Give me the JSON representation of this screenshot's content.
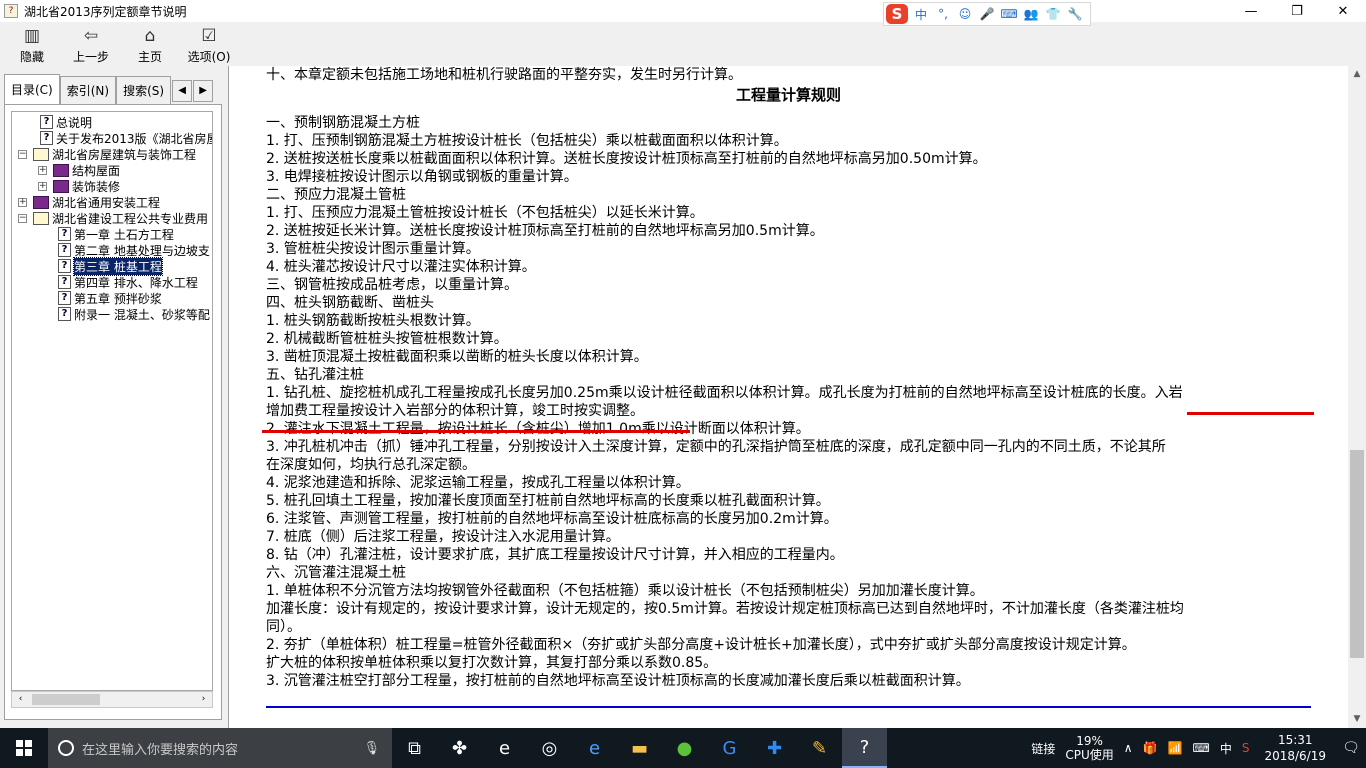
{
  "window": {
    "title": "湖北省2013序列定额章节说明",
    "caps": [
      "—",
      "❐",
      "✕"
    ]
  },
  "ime": {
    "items": [
      "中",
      "°,",
      "☺",
      "🎤",
      "⌨",
      "👥",
      "👕",
      "🔧"
    ]
  },
  "toolbar": {
    "buttons": [
      {
        "label": "隐藏",
        "icon": "hide-icon"
      },
      {
        "label": "上一步",
        "icon": "back-icon"
      },
      {
        "label": "主页",
        "icon": "home-icon"
      },
      {
        "label": "选项(O)",
        "icon": "options-icon"
      }
    ]
  },
  "tabs": [
    "目录(C)",
    "索引(N)",
    "搜索(S)"
  ],
  "tree": {
    "items": [
      {
        "label": "总说明"
      },
      {
        "label": "关于发布2013版《湖北省房屋"
      },
      {
        "label": "湖北省房屋建筑与装饰工程"
      },
      {
        "label": "结构屋面"
      },
      {
        "label": "装饰装修"
      },
      {
        "label": "湖北省通用安装工程"
      },
      {
        "label": "湖北省建设工程公共专业费用"
      },
      {
        "label": "第一章  土石方工程"
      },
      {
        "label": "第二章  地基处理与边坡支"
      },
      {
        "label": "第三章  桩基工程"
      },
      {
        "label": "第四章  排水、降水工程"
      },
      {
        "label": "第五章  预拌砂浆"
      },
      {
        "label": "附录一  混凝土、砂浆等配"
      }
    ]
  },
  "content": {
    "intro": "十、本章定额未包括施工场地和桩机行驶路面的平整夯实，发生时另行计算。",
    "title": "工程量计算规则",
    "lines": [
      "一、预制钢筋混凝土方桩",
      "1. 打、压预制钢筋混凝土方桩按设计桩长（包括桩尖）乘以桩截面面积以体积计算。",
      "2. 送桩按送桩长度乘以桩截面面积以体积计算。送桩长度按设计桩顶标高至打桩前的自然地坪标高另加0.50m计算。",
      "3. 电焊接桩按设计图示以角钢或钢板的重量计算。",
      "二、预应力混凝土管桩",
      "1. 打、压预应力混凝土管桩按设计桩长（不包括桩尖）以延长米计算。",
      "2. 送桩按延长米计算。送桩长度按设计桩顶标高至打桩前的自然地坪标高另加0.5m计算。",
      "3. 管桩桩尖按设计图示重量计算。",
      "4. 桩头灌芯按设计尺寸以灌注实体积计算。",
      "三、钢管桩按成品桩考虑，以重量计算。",
      "四、桩头钢筋截断、凿桩头",
      "1. 桩头钢筋截断按桩头根数计算。",
      "2. 机械截断管桩桩头按管桩根数计算。",
      "3. 凿桩顶混凝土按桩截面积乘以凿断的桩头长度以体积计算。",
      "五、钻孔灌注桩"
    ],
    "para1_a": "1. 钻孔桩、旋挖桩机成孔工程量按成孔长度另加0.25m乘以设计桩径截面积以体积计算。成孔长度为打桩前的自然地坪标高至设计桩底的长度。入岩",
    "para1_b": "增加费工程量按设计入岩部分的体积计算，竣工时按实调整。",
    "lines2": [
      "2. 灌注水下混凝土工程量，按设计桩长（含桩尖）增加1.0m乘以设计断面以体积计算。",
      "3. 冲孔桩机冲击（抓）锤冲孔工程量，分别按设计入土深度计算，定额中的孔深指护筒至桩底的深度，成孔定额中同一孔内的不同土质，不论其所",
      "在深度如何，均执行总孔深定额。",
      "4. 泥浆池建造和拆除、泥浆运输工程量，按成孔工程量以体积计算。",
      "5. 桩孔回填土工程量，按加灌长度顶面至打桩前自然地坪标高的长度乘以桩孔截面积计算。",
      "6. 注浆管、声测管工程量，按打桩前的自然地坪标高至设计桩底标高的长度另加0.2m计算。",
      "7. 桩底（侧）后注浆工程量，按设计注入水泥用量计算。",
      "8. 钻（冲）孔灌注桩，设计要求扩底，其扩底工程量按设计尺寸计算，并入相应的工程量内。",
      "六、沉管灌注混凝土桩",
      "1. 单桩体积不分沉管方法均按钢管外径截面积（不包括桩箍）乘以设计桩长（不包括预制桩尖）另加加灌长度计算。",
      "加灌长度：设计有规定的，按设计要求计算，设计无规定的，按0.5m计算。若按设计规定桩顶标高已达到自然地坪时，不计加灌长度（各类灌注桩均",
      "同）。",
      "2. 夯扩（单桩体积）桩工程量=桩管外径截面积×（夯扩或扩头部分高度+设计桩长+加灌长度），式中夯扩或扩头部分高度按设计规定计算。",
      "扩大桩的体积按单桩体积乘以复打次数计算，其复打部分乘以系数0.85。",
      "3. 沉管灌注桩空打部分工程量，按打桩前的自然地坪标高至设计桩顶标高的长度减加灌长度后乘以桩截面积计算。"
    ]
  },
  "taskbar": {
    "search_placeholder": "在这里输入你要搜索的内容",
    "apps": [
      "task-view-icon",
      "pinwheel-icon",
      "edge-icon",
      "browser-icon",
      "ie-icon",
      "folder-icon",
      "app-green-icon",
      "app-g-icon",
      "app-plus-icon",
      "notes-icon",
      "help-app-icon"
    ],
    "link_label": "链接",
    "cpu_percent": "19%",
    "cpu_label": "CPU使用",
    "ime_lang": "中",
    "time": "15:31",
    "date": "2018/6/19"
  }
}
